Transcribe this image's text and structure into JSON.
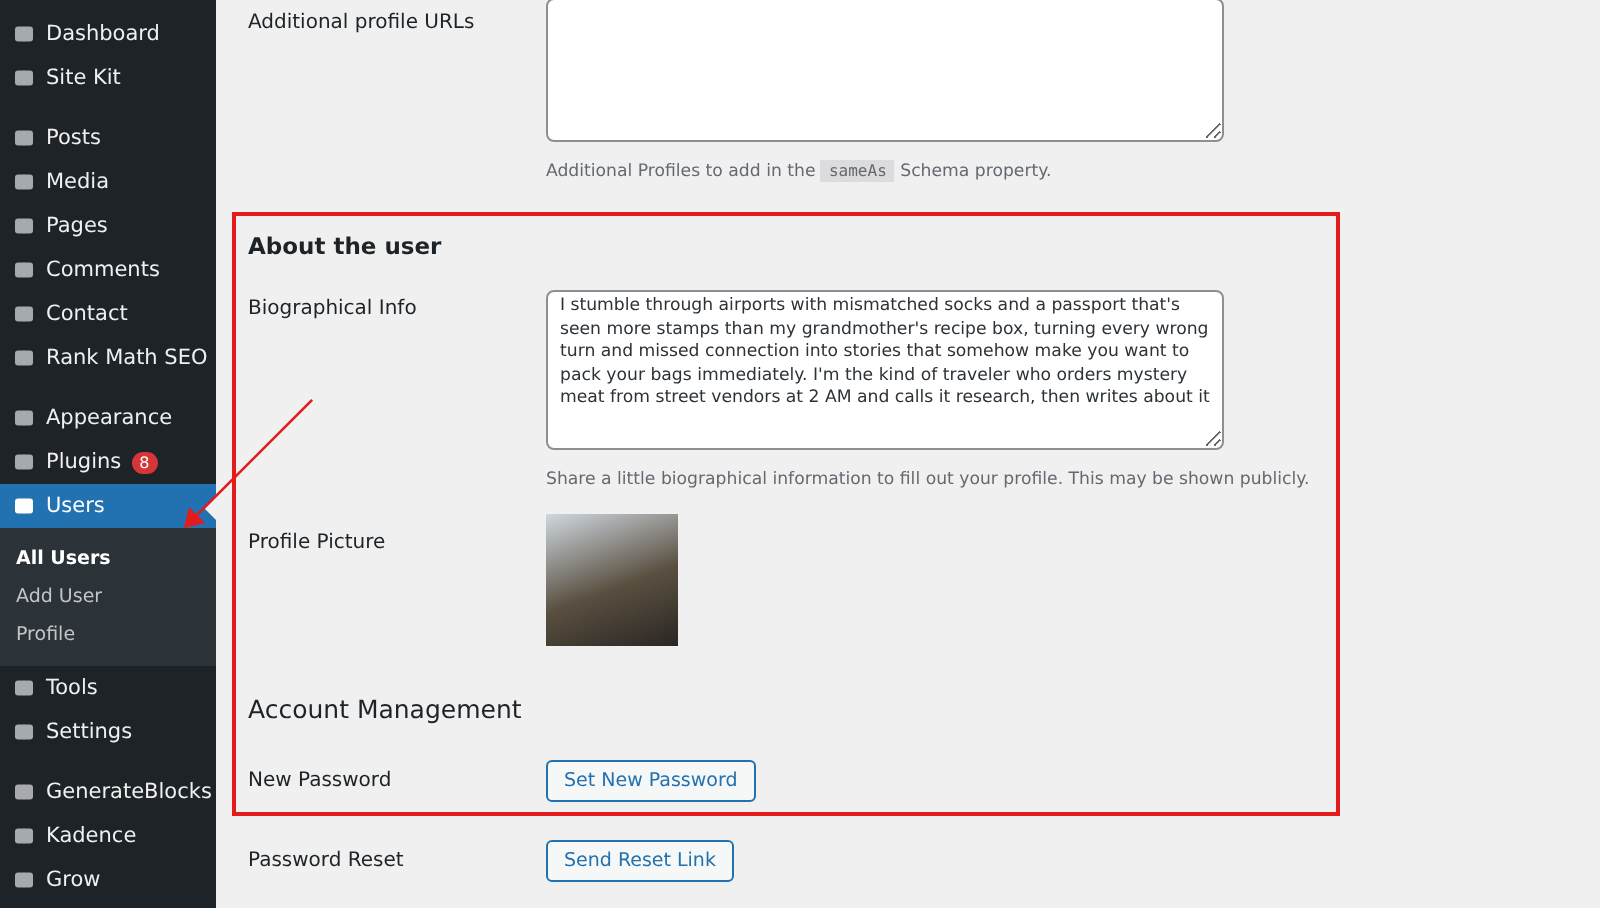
{
  "sidebar": {
    "groups": [
      [
        {
          "label": "Dashboard",
          "selected": false
        },
        {
          "label": "Site Kit",
          "selected": false
        }
      ],
      [
        {
          "label": "Posts",
          "selected": false
        },
        {
          "label": "Media",
          "selected": false
        },
        {
          "label": "Pages",
          "selected": false
        },
        {
          "label": "Comments",
          "selected": false
        },
        {
          "label": "Contact",
          "selected": false
        },
        {
          "label": "Rank Math SEO",
          "selected": false
        }
      ],
      [
        {
          "label": "Appearance",
          "selected": false
        },
        {
          "label": "Plugins",
          "selected": false,
          "badge": "8"
        },
        {
          "label": "Users",
          "selected": true,
          "submenu": [
            {
              "label": "All Users",
              "selected": true
            },
            {
              "label": "Add User",
              "selected": false
            },
            {
              "label": "Profile",
              "selected": false
            }
          ]
        },
        {
          "label": "Tools",
          "selected": false
        },
        {
          "label": "Settings",
          "selected": false
        }
      ],
      [
        {
          "label": "GenerateBlocks",
          "selected": false
        },
        {
          "label": "Kadence",
          "selected": false
        },
        {
          "label": "Grow",
          "selected": false
        }
      ]
    ]
  },
  "additional_urls": {
    "label": "Additional profile URLs",
    "description_before": "Additional Profiles to add in the",
    "code": "sameAs",
    "description_after": "Schema property."
  },
  "about": {
    "heading": "About the user",
    "bio_label": "Biographical Info",
    "bio_value": "I stumble through airports with mismatched socks and a passport that's seen more stamps than my grandmother's recipe box, turning every wrong turn and missed connection into stories that somehow make you want to pack your bags immediately. I'm the kind of traveler who orders mystery meat from street vendors at 2 AM and calls it research, then writes about it",
    "bio_description": "Share a little biographical information to fill out your profile. This may be shown publicly.",
    "picture_label": "Profile Picture"
  },
  "account": {
    "heading": "Account Management",
    "rows": [
      {
        "label": "New Password",
        "button": "Set New Password"
      },
      {
        "label": "Password Reset",
        "button": "Send Reset Link"
      }
    ]
  }
}
